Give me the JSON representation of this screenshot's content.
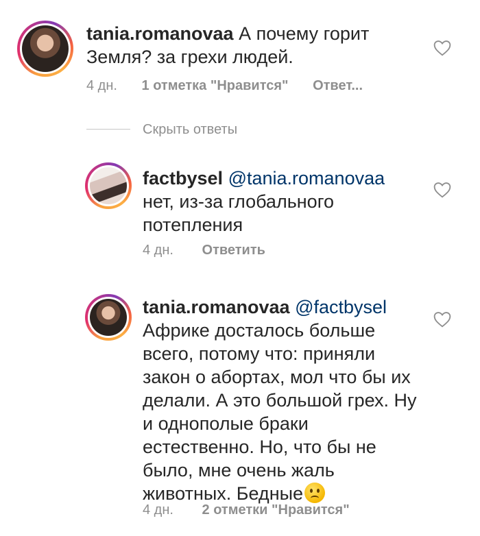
{
  "comments": [
    {
      "username": "tania.romanovaa",
      "mention": "",
      "text": "А почему горит Земля? за грехи людей.",
      "time": "4 дн.",
      "likes": "1 отметка \"Нравится\"",
      "reply": "Ответ..."
    },
    {
      "username": "factbysel",
      "mention": "@tania.romanovaa",
      "text": "нет, из-за глобального потепления",
      "time": "4 дн.",
      "likes": "",
      "reply": "Ответить"
    },
    {
      "username": "tania.romanovaa",
      "mention": "@factbysel",
      "text": "Африке досталось больше всего, потому что: приняли закон о абортах, мол что бы их делали. А это большой грех. Ну и однополые браки естественно. Но, что бы не было, мне очень жаль животных. Бедные",
      "emoji": "confused-face",
      "time": "4 дн.",
      "likes": "2 отметки \"Нравится\"",
      "reply": ""
    }
  ],
  "replies_toggle": "Скрыть ответы",
  "icons": {
    "like": "heart-outline-icon"
  },
  "colors": {
    "text": "#262626",
    "meta": "#8e8e8e",
    "mention": "#003569"
  }
}
